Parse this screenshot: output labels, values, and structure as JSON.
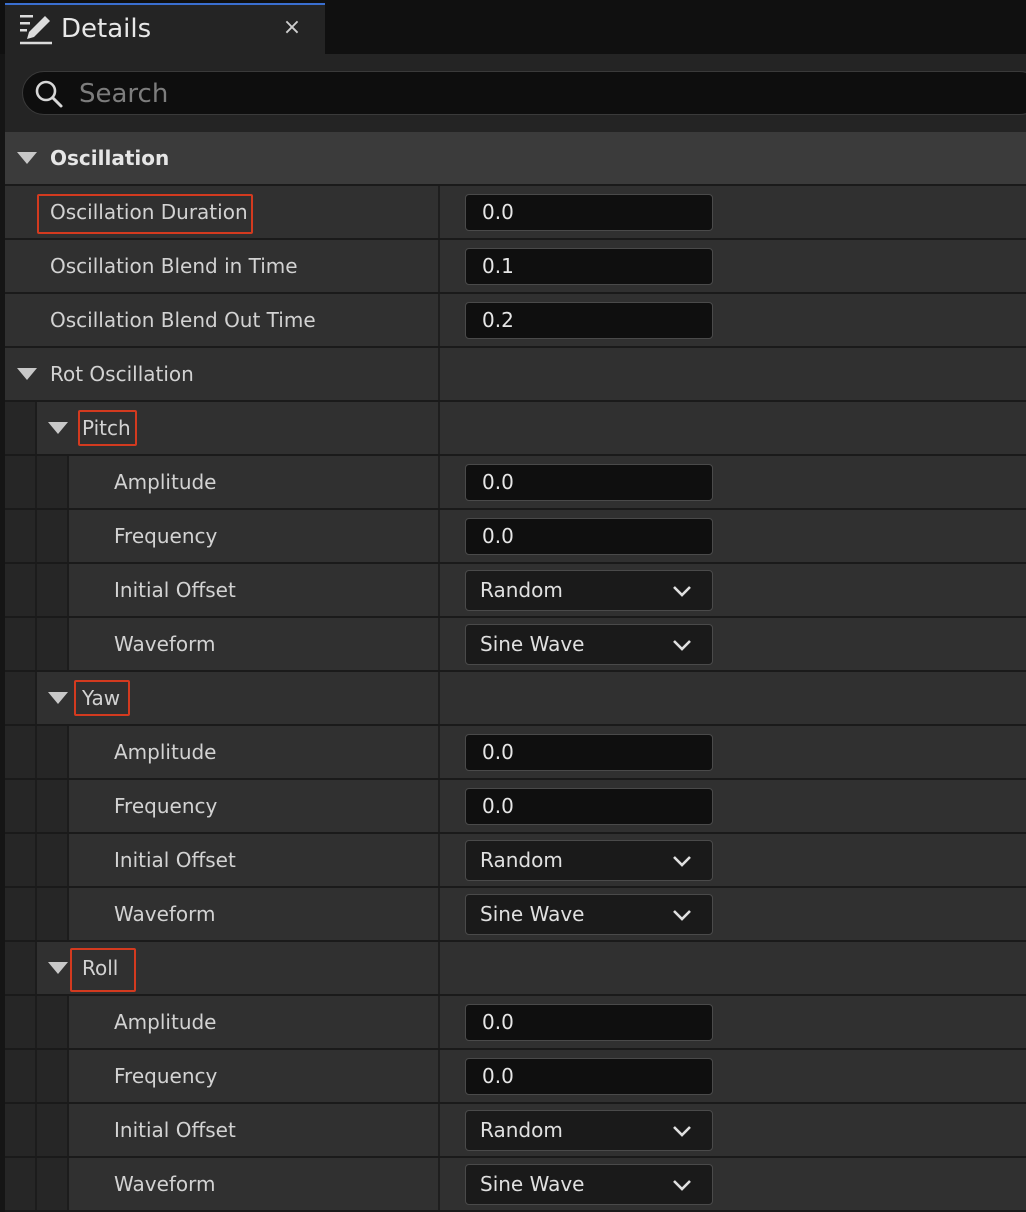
{
  "tab": {
    "title": "Details",
    "icon": "pencil-edit-icon",
    "close_label": "×"
  },
  "search": {
    "placeholder": "Search",
    "value": ""
  },
  "colors": {
    "highlight_box": "#d33a1f",
    "tab_accent": "#3a6fd0"
  },
  "sections": {
    "oscillation": {
      "label": "Oscillation",
      "duration_label": "Oscillation Duration",
      "duration_value": "0.0",
      "blend_in_label": "Oscillation Blend in Time",
      "blend_in_value": "0.1",
      "blend_out_label": "Oscillation Blend Out Time",
      "blend_out_value": "0.2"
    },
    "rot_oscillation": {
      "label": "Rot Oscillation",
      "pitch": {
        "label": "Pitch",
        "amplitude_label": "Amplitude",
        "amplitude_value": "0.0",
        "frequency_label": "Frequency",
        "frequency_value": "0.0",
        "initial_offset_label": "Initial Offset",
        "initial_offset_value": "Random",
        "waveform_label": "Waveform",
        "waveform_value": "Sine Wave"
      },
      "yaw": {
        "label": "Yaw",
        "amplitude_label": "Amplitude",
        "amplitude_value": "0.0",
        "frequency_label": "Frequency",
        "frequency_value": "0.0",
        "initial_offset_label": "Initial Offset",
        "initial_offset_value": "Random",
        "waveform_label": "Waveform",
        "waveform_value": "Sine Wave"
      },
      "roll": {
        "label": "Roll",
        "amplitude_label": "Amplitude",
        "amplitude_value": "0.0",
        "frequency_label": "Frequency",
        "frequency_value": "0.0",
        "initial_offset_label": "Initial Offset",
        "initial_offset_value": "Random",
        "waveform_label": "Waveform",
        "waveform_value": "Sine Wave"
      }
    }
  }
}
